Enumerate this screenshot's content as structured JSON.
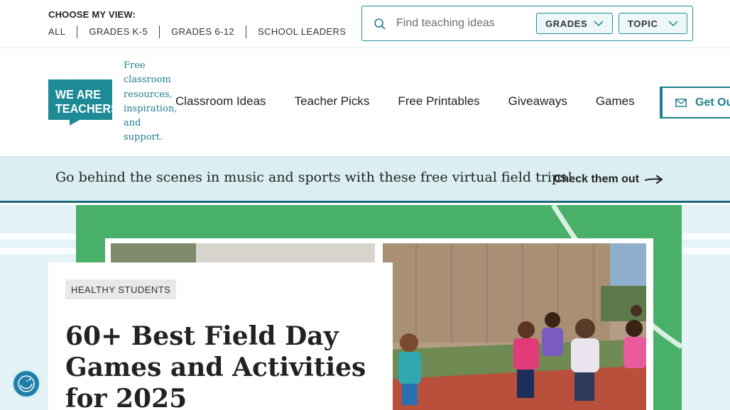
{
  "topbar": {
    "view_label": "CHOOSE MY VIEW:",
    "view_links": [
      "ALL",
      "GRADES K-5",
      "GRADES 6-12",
      "SCHOOL LEADERS"
    ]
  },
  "search": {
    "placeholder": "Find teaching ideas",
    "grades_label": "GRADES",
    "topic_label": "TOPIC"
  },
  "header": {
    "logo_text": "WE ARE TEACHERS",
    "tagline": "Free classroom resources, inspiration, and support.",
    "nav": [
      "Classroom Ideas",
      "Teacher Picks",
      "Free Printables",
      "Giveaways",
      "Games"
    ],
    "cta_label": "Get Ou"
  },
  "promo": {
    "text": "Go behind the scenes in music and sports with these free virtual field trips!",
    "link_label": "Check them out"
  },
  "article": {
    "category": "HEALTHY STUDENTS",
    "title": "60+ Best Field Day Games and Activities for 2025"
  },
  "colors": {
    "brand_teal": "#1d7f8e",
    "hero_green": "#48b068",
    "promo_bg": "#dbeef2",
    "accessibility_button": "#1f7fa9"
  },
  "icons": {
    "search": "search-icon",
    "chevron": "chevron-down-icon",
    "mail": "mail-icon",
    "arrow": "arrow-right-icon",
    "accessibility": "accessibility-icon"
  }
}
